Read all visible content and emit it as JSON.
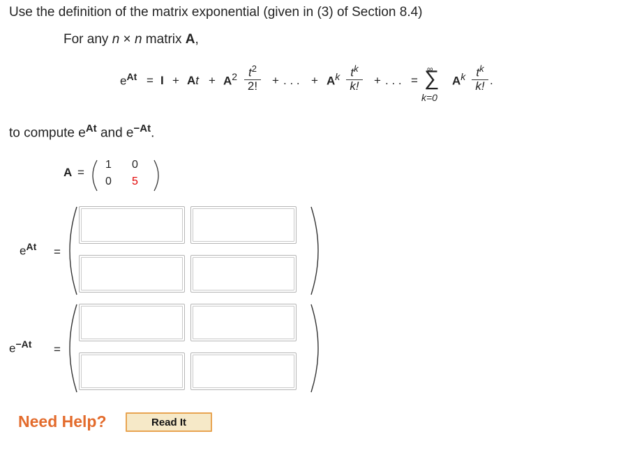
{
  "problem": {
    "intro": "Use the definition of the matrix exponential (given in (3) of Section 8.4)",
    "for_any_prefix": "For any ",
    "n1": "n",
    "times": " × ",
    "n2": "n",
    "matrix_word": " matrix ",
    "A_bold": "A",
    "comma": ",",
    "compute_text": "to compute e",
    "compute_At": "At",
    "compute_and": " and e",
    "compute_negAt": "−At",
    "compute_period": "."
  },
  "formula": {
    "lhs_e": "e",
    "lhs_sup": "At",
    "eq1": "=",
    "I": "I",
    "plus1": "+",
    "At_A": "A",
    "At_t": "t",
    "plus2": "+",
    "A2_A": "A",
    "A2_sup": "2",
    "frac1_num_t": "t",
    "frac1_num_sup": "2",
    "frac1_den": "2!",
    "plus3": "+",
    "dots1": ". . .",
    "plus4": "+",
    "Ak_A": "A",
    "Ak_sup": "k",
    "frac2_num_t": "t",
    "frac2_num_sup": "k",
    "frac2_den": "k!",
    "plus5": "+",
    "dots2": ". . .",
    "eq2": "=",
    "sigma": "∑",
    "sigma_top": "∞",
    "sigma_bottom": "k=0",
    "sum_A": "A",
    "sum_A_sup": "k",
    "frac3_num_t": "t",
    "frac3_num_sup": "k",
    "frac3_den": "k!",
    "period": "."
  },
  "matrix_A": {
    "label": "A",
    "eq": "=",
    "a11": "1",
    "a12": "0",
    "a21": "0",
    "a22": "5",
    "highlight_color": "#e10000"
  },
  "eAt": {
    "e": "e",
    "sup": "At",
    "eq": "=",
    "cells": [
      "",
      "",
      "",
      ""
    ]
  },
  "eNegAt": {
    "e": "e",
    "sup": "−At",
    "eq": "=",
    "cells": [
      "",
      "",
      "",
      ""
    ]
  },
  "help": {
    "label": "Need Help?",
    "read_button": "Read It"
  },
  "colors": {
    "help_orange": "#e36b2c",
    "button_border": "#e8a451",
    "button_fill": "#f6e9c8"
  }
}
